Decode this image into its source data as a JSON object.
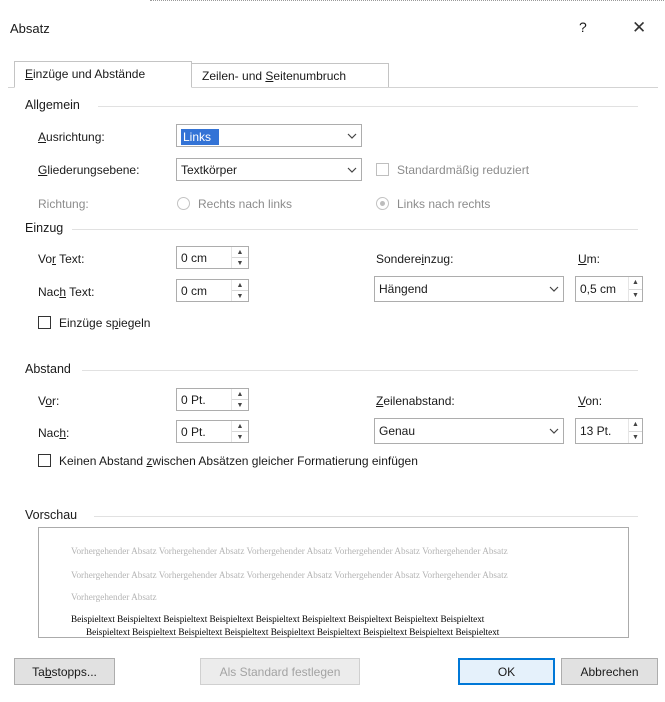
{
  "dialog": {
    "title": "Absatz",
    "help": "?",
    "close": "✕"
  },
  "tabs": [
    {
      "label_pre": "",
      "label_u": "E",
      "label_post": "inzüge und Abstände"
    },
    {
      "label_pre": "Zeilen- und ",
      "label_u": "S",
      "label_post": "eitenumbruch"
    }
  ],
  "allgemein": {
    "title": "Allgemein",
    "ausrichtung": {
      "label_u": "A",
      "label_post": "usrichtung:",
      "value": "Links"
    },
    "gliederung": {
      "label_u": "G",
      "label_post": "liederungsebene:",
      "value": "Textkörper"
    },
    "standard_reduziert": "Standardmäßig reduziert",
    "richtung": {
      "label": "Richtung:",
      "rtl": "Rechts nach links",
      "ltr": "Links nach rechts"
    }
  },
  "einzug": {
    "title": "Einzug",
    "vor_text": {
      "label_pre": "Vo",
      "label_u": "r",
      "label_post": " Text:",
      "value": "0 cm"
    },
    "nach_text": {
      "label_pre": "Nac",
      "label_u": "h",
      "label_post": " Text:",
      "value": "0 cm"
    },
    "sondereinzug": {
      "label_pre": "Sondere",
      "label_u": "i",
      "label_post": "nzug:",
      "value": "Hängend"
    },
    "um": {
      "label_u": "U",
      "label_post": "m:",
      "value": "0,5 cm"
    },
    "spiegeln": {
      "label_pre": "Einzüge s",
      "label_u": "p",
      "label_post": "iegeln"
    }
  },
  "abstand": {
    "title": "Abstand",
    "vor": {
      "label_pre": "V",
      "label_u": "o",
      "label_post": "r:",
      "value": "0 Pt."
    },
    "nach": {
      "label_pre": "Nac",
      "label_u": "h",
      "label_post": ":",
      "value": "0 Pt."
    },
    "zeilenabstand": {
      "label_u": "Z",
      "label_post": "eilenabstand:",
      "value": "Genau"
    },
    "von": {
      "label_u": "V",
      "label_post": "on:",
      "value": "13 Pt."
    },
    "kein_abstand": {
      "label_pre": "Keinen Abstand ",
      "label_u": "z",
      "label_post": "wischen Absätzen gleicher Formatierung einfügen"
    }
  },
  "vorschau": {
    "title": "Vorschau",
    "grey_lines": [
      "Vorhergehender Absatz Vorhergehender Absatz Vorhergehender Absatz Vorhergehender Absatz Vorhergehender Absatz",
      "Vorhergehender Absatz Vorhergehender Absatz Vorhergehender Absatz Vorhergehender Absatz Vorhergehender Absatz",
      "Vorhergehender Absatz"
    ],
    "dark_lines": [
      "Beispieltext Beispieltext Beispieltext Beispieltext Beispieltext Beispieltext Beispieltext Beispieltext Beispieltext",
      "Beispieltext Beispieltext Beispieltext Beispieltext Beispieltext Beispieltext Beispieltext Beispieltext Beispieltext"
    ]
  },
  "buttons": {
    "tabstopps": {
      "label_pre": "Ta",
      "label_u": "b",
      "label_post": "stopps..."
    },
    "standard": "Als Standard festlegen",
    "ok": "OK",
    "abbrechen": "Abbrechen"
  }
}
